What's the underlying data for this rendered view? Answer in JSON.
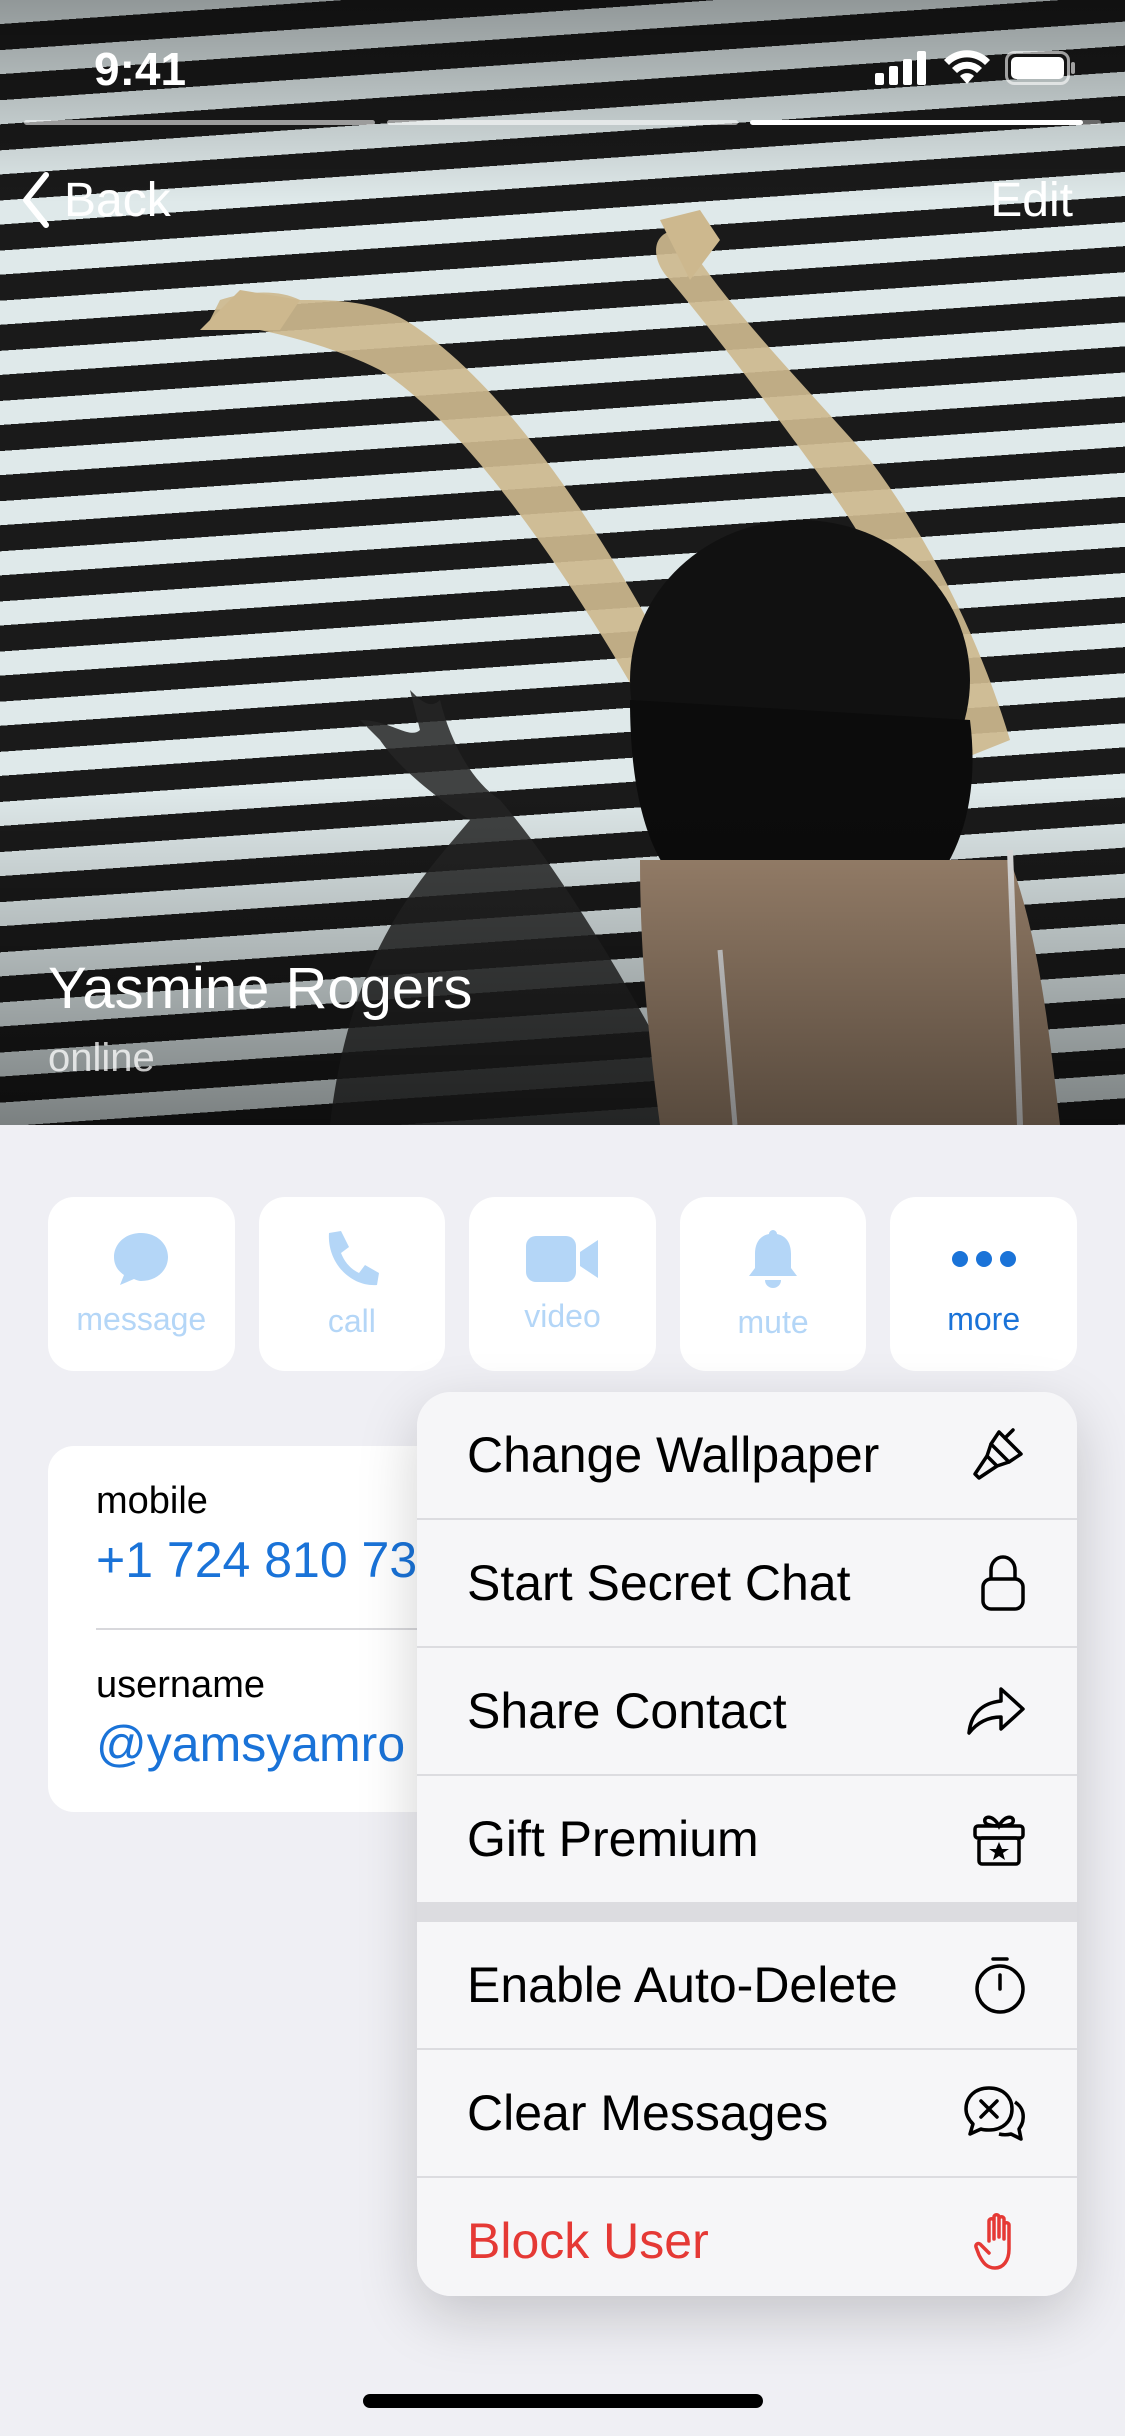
{
  "status_bar": {
    "time": "9:41"
  },
  "stories": {
    "segments": [
      1,
      1,
      0.95
    ]
  },
  "nav": {
    "back_label": "Back",
    "edit_label": "Edit"
  },
  "profile": {
    "name": "Yasmine Rogers",
    "status": "online"
  },
  "actions": [
    {
      "label": "message",
      "icon": "message-bubble-icon",
      "active": false
    },
    {
      "label": "call",
      "icon": "phone-icon",
      "active": false
    },
    {
      "label": "video",
      "icon": "video-camera-icon",
      "active": false
    },
    {
      "label": "mute",
      "icon": "bell-icon",
      "active": false
    },
    {
      "label": "more",
      "icon": "ellipsis-icon",
      "active": true
    }
  ],
  "info": {
    "mobile_label": "mobile",
    "mobile_value": "+1 724 810 73",
    "username_label": "username",
    "username_value": "@yamsyamro"
  },
  "menu": {
    "items": [
      {
        "label": "Change Wallpaper",
        "icon": "paintbrush-icon"
      },
      {
        "label": "Start Secret Chat",
        "icon": "lock-icon"
      },
      {
        "label": "Share Contact",
        "icon": "share-arrow-icon"
      },
      {
        "label": "Gift Premium",
        "icon": "gift-icon"
      },
      {
        "label": "Enable Auto-Delete",
        "icon": "timer-icon"
      },
      {
        "label": "Clear Messages",
        "icon": "clear-chat-icon"
      },
      {
        "label": "Block User",
        "icon": "hand-stop-icon",
        "danger": true
      }
    ]
  },
  "colors": {
    "accent": "#1A73D8",
    "accent_light": "#B4D6F7",
    "danger": "#E53935",
    "background": "#EFEFF4"
  }
}
